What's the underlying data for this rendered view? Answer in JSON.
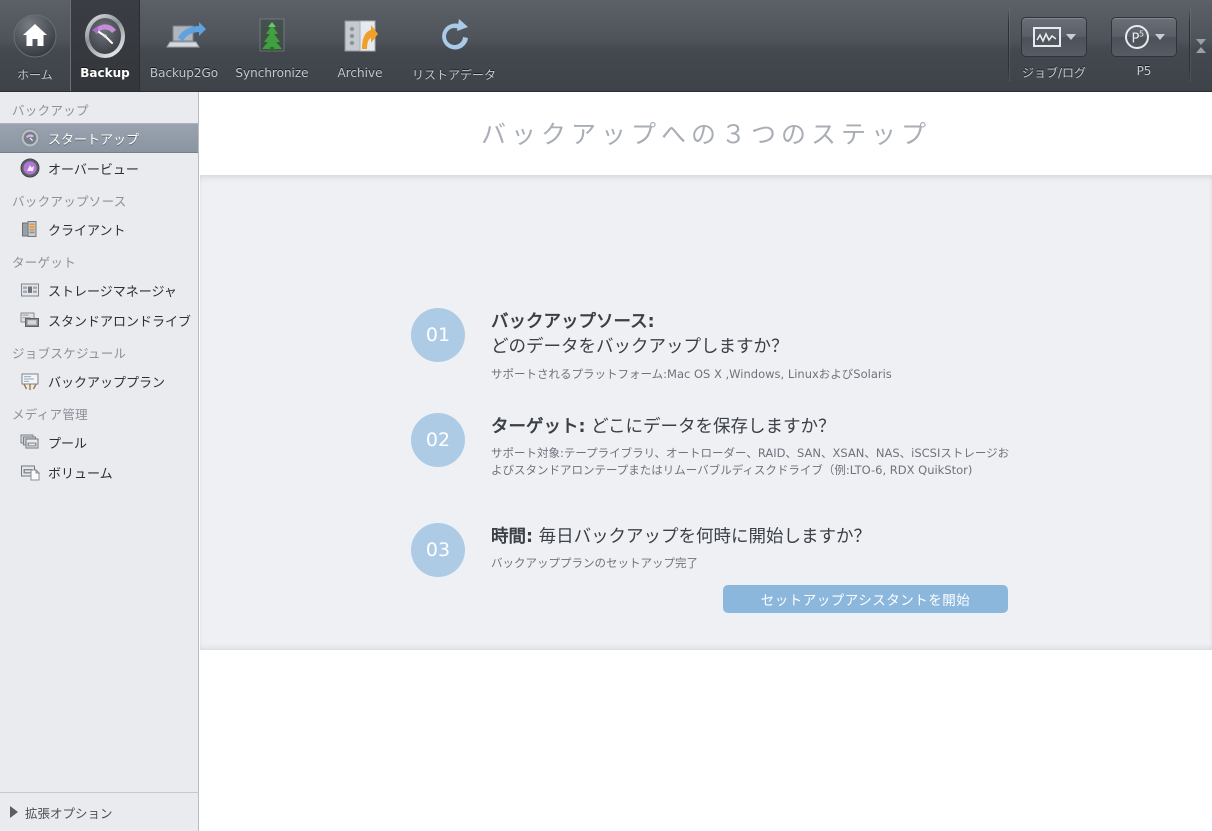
{
  "toolbar": {
    "items": [
      {
        "label": "ホーム",
        "icon": "home-icon",
        "selected": false
      },
      {
        "label": "Backup",
        "icon": "backup-clock-icon",
        "selected": true
      },
      {
        "label": "Backup2Go",
        "icon": "laptop-arrow-icon",
        "selected": false
      },
      {
        "label": "Synchronize",
        "icon": "sync-tree-icon",
        "selected": false
      },
      {
        "label": "Archive",
        "icon": "safe-arrow-icon",
        "selected": false
      },
      {
        "label": "リストアデータ",
        "icon": "restore-arrow-icon",
        "selected": false
      }
    ],
    "right_items": [
      {
        "label": "ジョブ/ログ",
        "icon": "waveform-icon"
      },
      {
        "label": "P5",
        "icon": "p5-badge-icon"
      }
    ]
  },
  "sidebar": {
    "groups": [
      {
        "heading": "バックアップ",
        "items": [
          {
            "label": "スタートアップ",
            "icon": "startup-dial-icon",
            "active": true
          },
          {
            "label": "オーバービュー",
            "icon": "overview-globe-icon",
            "active": false
          }
        ]
      },
      {
        "heading": "バックアップソース",
        "items": [
          {
            "label": "クライアント",
            "icon": "client-server-icon",
            "active": false
          }
        ]
      },
      {
        "heading": "ターゲット",
        "items": [
          {
            "label": "ストレージマネージャ",
            "icon": "storage-manager-icon",
            "active": false
          },
          {
            "label": "スタンドアロンドライブ",
            "icon": "standalone-drive-icon",
            "active": false
          }
        ]
      },
      {
        "heading": "ジョブスケジュール",
        "items": [
          {
            "label": "バックアッププラン",
            "icon": "backup-plan-easel-icon",
            "active": false
          }
        ]
      },
      {
        "heading": "メディア管理",
        "items": [
          {
            "label": "プール",
            "icon": "pool-tapes-icon",
            "active": false
          },
          {
            "label": "ボリューム",
            "icon": "volume-tape-icon",
            "active": false
          }
        ]
      }
    ],
    "extended_options": {
      "label": "拡張オプション",
      "icon": "triangle-right-icon"
    }
  },
  "main": {
    "page_title": "バックアップへの３つのステップ",
    "steps": [
      {
        "number": "01",
        "title_bold": "バックアップソース:",
        "title_rest": "どのデータをバックアップしますか？",
        "two_line": true,
        "desc": "サポートされるプラットフォーム:Mac OS X ,Windows, LinuxおよびSolaris"
      },
      {
        "number": "02",
        "title_bold": "ターゲット:",
        "title_rest": " どこにデータを保存しますか？",
        "two_line": false,
        "desc": "サポート対象:テープライブラリ、オートローダー、RAID、SAN、XSAN、NAS、iSCSIストレージおよびスタンドアロンテープまたはリムーバブルディスクドライブ（例:LTO-6, RDX QuikStor)"
      },
      {
        "number": "03",
        "title_bold": "時間:",
        "title_rest": " 毎日バックアップを何時に開始しますか？",
        "two_line": false,
        "desc": "バックアッププランのセットアップ完了"
      }
    ],
    "start_button": "セットアップアシスタントを開始"
  },
  "colors": {
    "toolbar_bg": "#4e535a",
    "sidebar_bg": "#e9ebee",
    "panel_bg": "#eff0f4",
    "step_circle": "#aecbe5",
    "accent_button": "#8cb7dd",
    "title_gray": "#a9aeb6"
  }
}
